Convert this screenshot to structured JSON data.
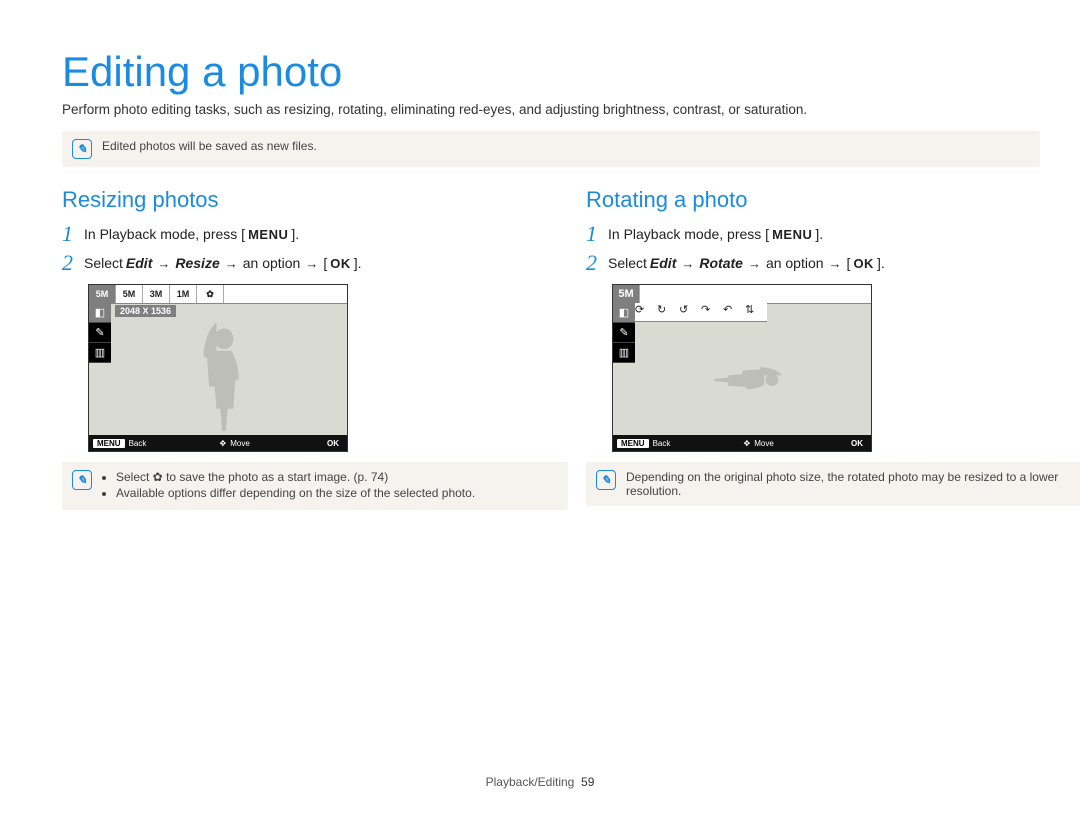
{
  "title": "Editing a photo",
  "intro": "Perform photo editing tasks, such as resizing, rotating, eliminating red-eyes, and adjusting brightness, contrast, or saturation.",
  "top_note": "Edited photos will be saved as new files.",
  "left": {
    "heading": "Resizing photos",
    "step1": {
      "label_in": "In Playback mode, press [",
      "menu": "MENU",
      "bracket_close": "].",
      "rest": "   "
    },
    "step2": {
      "a": "Select ",
      "edit_word": "Edit",
      "arrow1": "→",
      "resize_word": "Resize",
      "arrow2": "→",
      "b": " an option ",
      "arrow3": "→",
      "ok": "OK",
      "bracket_a": " [",
      "bracket_b": "]."
    },
    "lcd": {
      "tabs": [
        "5M",
        "5M",
        "3M",
        "1M",
        "✿"
      ],
      "caption": "2048 X 1536",
      "left_icons": [
        "◧",
        "✎",
        "▥"
      ],
      "bottom_back": "Back",
      "bottom_move": "Move",
      "bottom_ok": "OK"
    },
    "note_items": [
      "Select ✿ to save the photo as a start image. (p. 74)",
      "Available options differ depending on the size of the selected photo."
    ]
  },
  "right": {
    "heading": "Rotating a photo",
    "step1": {
      "label_in": "In Playback mode, press [",
      "menu": "MENU",
      "bracket_close": "].",
      "rest": "   "
    },
    "step2": {
      "a": "Select ",
      "edit_word": "Edit",
      "arrow1": "→",
      "rotate_word": "Rotate",
      "arrow2": "→",
      "b": " an option ",
      "arrow3": "→",
      "ok": "OK",
      "bracket_a": " [",
      "bracket_b": "]."
    },
    "lcd": {
      "tabs": [
        "5M"
      ],
      "rot_icons": [
        "⟳",
        "↻",
        "↺",
        "↷",
        "↶",
        "⇅"
      ],
      "left_icons": [
        "◧",
        "✎",
        "▥"
      ],
      "bottom_back": "Back",
      "bottom_move": "Move",
      "bottom_ok": "OK"
    },
    "note_text": "Depending on the original photo size, the rotated photo may be resized to a lower resolution."
  },
  "footer_section": "Playback/Editing",
  "footer_page": "59",
  "icons": {
    "note": "✎",
    "play": "▶",
    "menu_btn": "MENU",
    "nav": "✥",
    "ok_btn": "OK"
  }
}
